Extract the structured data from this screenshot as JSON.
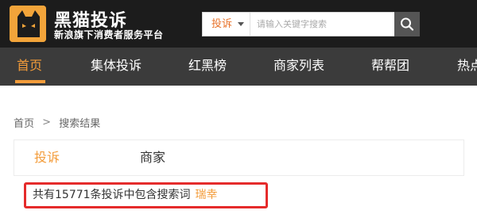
{
  "header": {
    "logo_title": "黑猫投诉",
    "logo_subtitle": "新浪旗下消费者服务平台",
    "search": {
      "type_label": "投诉",
      "placeholder": "请输入关键字搜索",
      "button_icon": "search-icon"
    }
  },
  "nav": {
    "items": [
      {
        "label": "首页",
        "active": true
      },
      {
        "label": "集体投诉",
        "active": false
      },
      {
        "label": "红黑榜",
        "active": false
      },
      {
        "label": "商家列表",
        "active": false
      },
      {
        "label": "帮帮团",
        "active": false
      },
      {
        "label": "热点",
        "active": false
      }
    ]
  },
  "breadcrumb": {
    "home": "首页",
    "separator": ">",
    "current": "搜索结果"
  },
  "tabs": [
    {
      "label": "投诉",
      "active": true
    },
    {
      "label": "商家",
      "active": false
    }
  ],
  "result": {
    "prefix": "共有",
    "count": "15771",
    "middle": "条投诉中包含搜索词",
    "keyword": "瑞幸"
  },
  "colors": {
    "accent": "#f39c3a",
    "header_bg": "#1c1c1c",
    "nav_bg": "#3b3b3b",
    "highlight_border": "#e52b2b"
  }
}
